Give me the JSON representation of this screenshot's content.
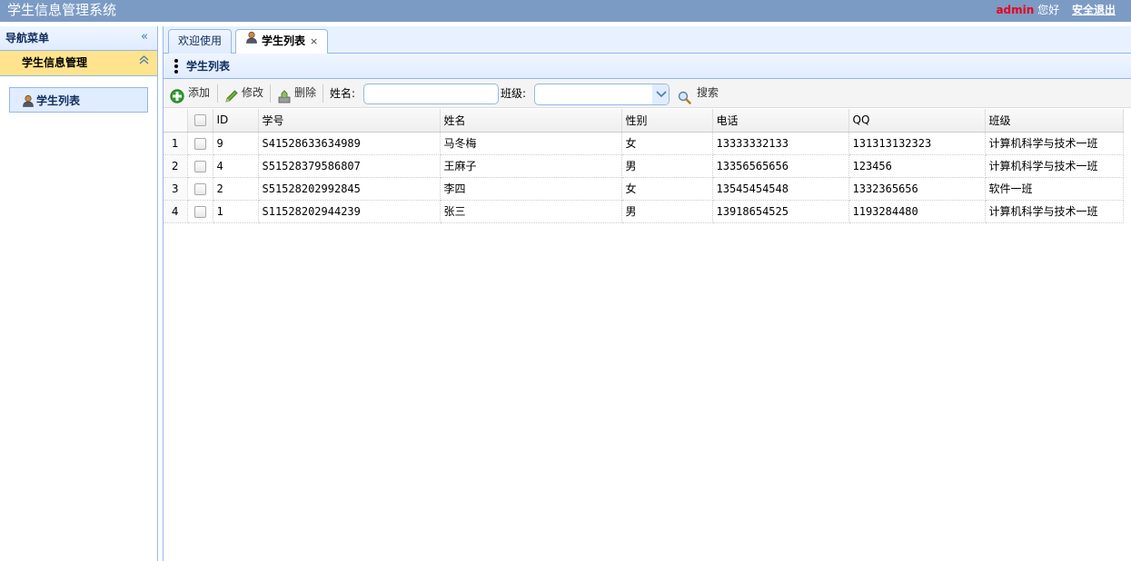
{
  "header": {
    "title": "学生信息管理系统",
    "user": "admin",
    "greeting": "您好",
    "logout": "安全退出"
  },
  "nav": {
    "title": "导航菜单",
    "section": "学生信息管理",
    "items": [
      {
        "label": "学生列表",
        "icon": "user-icon"
      }
    ]
  },
  "tabs": [
    {
      "label": "欢迎使用",
      "active": false
    },
    {
      "label": "学生列表",
      "active": true,
      "icon": "user-icon"
    }
  ],
  "panel": {
    "title": "学生列表"
  },
  "toolbar": {
    "add": "添加",
    "edit": "修改",
    "delete": "删除",
    "name_label": "姓名:",
    "name_value": "",
    "class_label": "班级:",
    "class_value": "",
    "search": "搜索"
  },
  "grid": {
    "columns": [
      "ID",
      "学号",
      "姓名",
      "性别",
      "电话",
      "QQ",
      "班级"
    ],
    "rows": [
      {
        "rn": "1",
        "id": "9",
        "sn": "S41528633634989",
        "name": "马冬梅",
        "gender": "女",
        "phone": "13333332133",
        "qq": "131313132323",
        "cls": "计算机科学与技术一班"
      },
      {
        "rn": "2",
        "id": "4",
        "sn": "S51528379586807",
        "name": "王麻子",
        "gender": "男",
        "phone": "13356565656",
        "qq": "123456",
        "cls": "计算机科学与技术一班"
      },
      {
        "rn": "3",
        "id": "2",
        "sn": "S51528202992845",
        "name": "李四",
        "gender": "女",
        "phone": "13545454548",
        "qq": "1332365656",
        "cls": "软件一班"
      },
      {
        "rn": "4",
        "id": "1",
        "sn": "S11528202944239",
        "name": "张三",
        "gender": "男",
        "phone": "13918654525",
        "qq": "1193284480",
        "cls": "计算机科学与技术一班"
      }
    ]
  },
  "colors": {
    "header_bg": "#7b9bc4",
    "accent_border": "#95b8e7",
    "selected_section": "#ffe48d",
    "admin_red": "#e8001c"
  }
}
